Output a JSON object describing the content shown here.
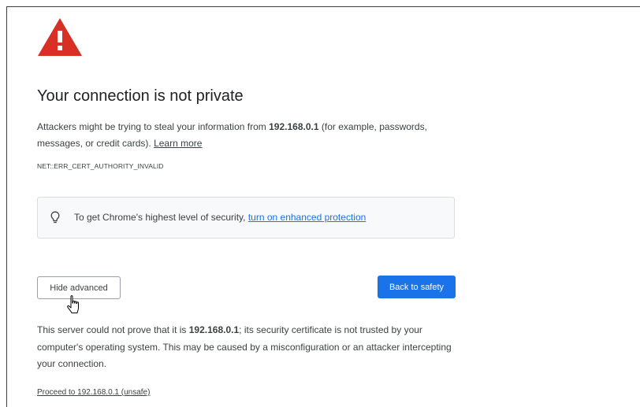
{
  "page": {
    "title": "Your connection is not private",
    "intro": {
      "part1": "Attackers might be trying to steal your information from ",
      "host": "192.168.0.1",
      "part2": " (for example, passwords, messages, or credit cards). ",
      "learn_more": "Learn more"
    },
    "error_code": "NET::ERR_CERT_AUTHORITY_INVALID",
    "tip": {
      "text": "To get Chrome's highest level of security, ",
      "link": "turn on enhanced protection"
    },
    "buttons": {
      "hide_advanced": "Hide advanced",
      "back_to_safety": "Back to safety"
    },
    "details": {
      "part1": "This server could not prove that it is ",
      "host": "192.168.0.1",
      "part2": "; its security certificate is not trusted by your computer's operating system. This may be caused by a misconfiguration or an attacker intercepting your connection."
    },
    "proceed_link": "Proceed to 192.168.0.1 (unsafe)",
    "colors": {
      "warning_red": "#d93025",
      "primary_blue": "#1a73e8",
      "text": "#3c4043"
    },
    "icons": [
      "warning-triangle-icon",
      "lightbulb-icon",
      "hand-cursor-icon"
    ]
  }
}
